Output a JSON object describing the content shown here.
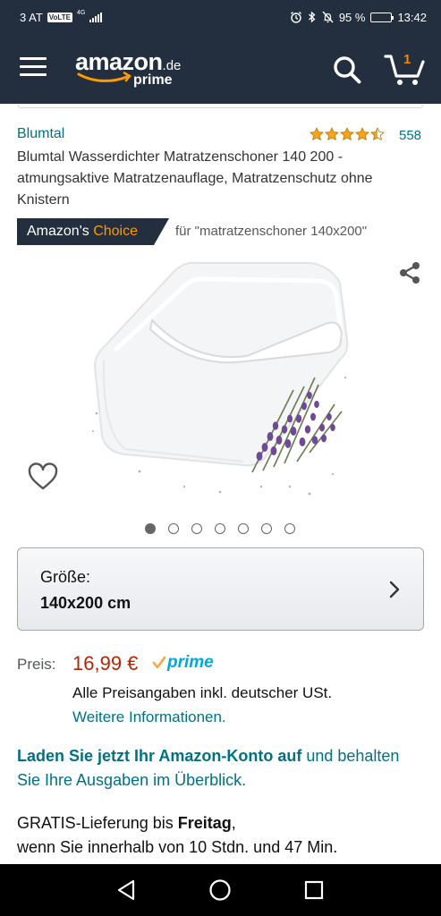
{
  "status_bar": {
    "carrier": "3 AT",
    "volte": "VoLTE",
    "network": "4G",
    "battery_percent": "95 %",
    "battery_level": 0.95,
    "time": "13:42"
  },
  "header": {
    "logo_word": "amazon",
    "logo_tld": ".de",
    "logo_prime": "prime",
    "cart_count": "1"
  },
  "product": {
    "brand": "Blumtal",
    "rating_stars": 4.5,
    "rating_count": "558",
    "title": "Blumtal Wasserdichter Matratzenschoner 140 200 - atmungsaktive Matratzenauflage, Matratzenschutz ohne Knistern",
    "choice_prefix": "Amazon's",
    "choice_word": "Choice",
    "choice_query": "für \"matratzenschoner 140x200\"",
    "image_count": 7,
    "active_image": 0
  },
  "size": {
    "label": "Größe:",
    "value": "140x200 cm"
  },
  "price": {
    "label": "Preis:",
    "value": "16,99 €",
    "prime": "prime",
    "tax_note": "Alle Preisangaben inkl. deutscher USt.",
    "more_info": "Weitere Informationen."
  },
  "promo": {
    "bold": "Laden Sie jetzt Ihr Amazon-Konto auf",
    "rest": " und behalten Sie Ihre Ausgaben im Überblick."
  },
  "delivery": {
    "prefix": "GRATIS-Lieferung bis ",
    "day": "Freitag",
    "suffix": ",",
    "line2": "wenn Sie innerhalb von 10 Stdn. und 47 Min."
  },
  "colors": {
    "header_bg": "#232f3e",
    "link": "#007185",
    "price": "#b12704",
    "accent": "#ff9900",
    "prime": "#00a8e1"
  }
}
